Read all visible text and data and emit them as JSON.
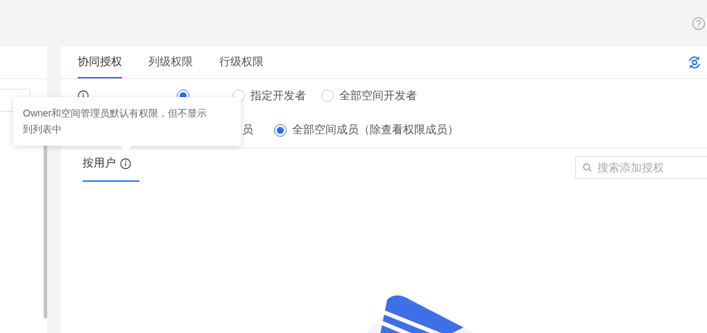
{
  "tabs": [
    {
      "label": "协同授权",
      "selected": true
    },
    {
      "label": "列级权限",
      "selected": false
    },
    {
      "label": "行级权限",
      "selected": false
    }
  ],
  "edit_permission": {
    "options": [
      {
        "selected": true
      },
      {
        "label": "指定开发者",
        "selected": false
      },
      {
        "label": "全部空间开发者",
        "selected": false
      }
    ]
  },
  "view_permission": {
    "partial_text": "员",
    "options": [
      {
        "label": "全部空间成员（除查看权限成员）",
        "selected": true
      }
    ]
  },
  "sub_tabs": [
    {
      "label": "按用户",
      "selected": true
    }
  ],
  "search": {
    "placeholder": "搜索添加授权"
  },
  "tooltip": {
    "text": "Owner和空间管理员默认有权限，但不显示到列表中"
  }
}
